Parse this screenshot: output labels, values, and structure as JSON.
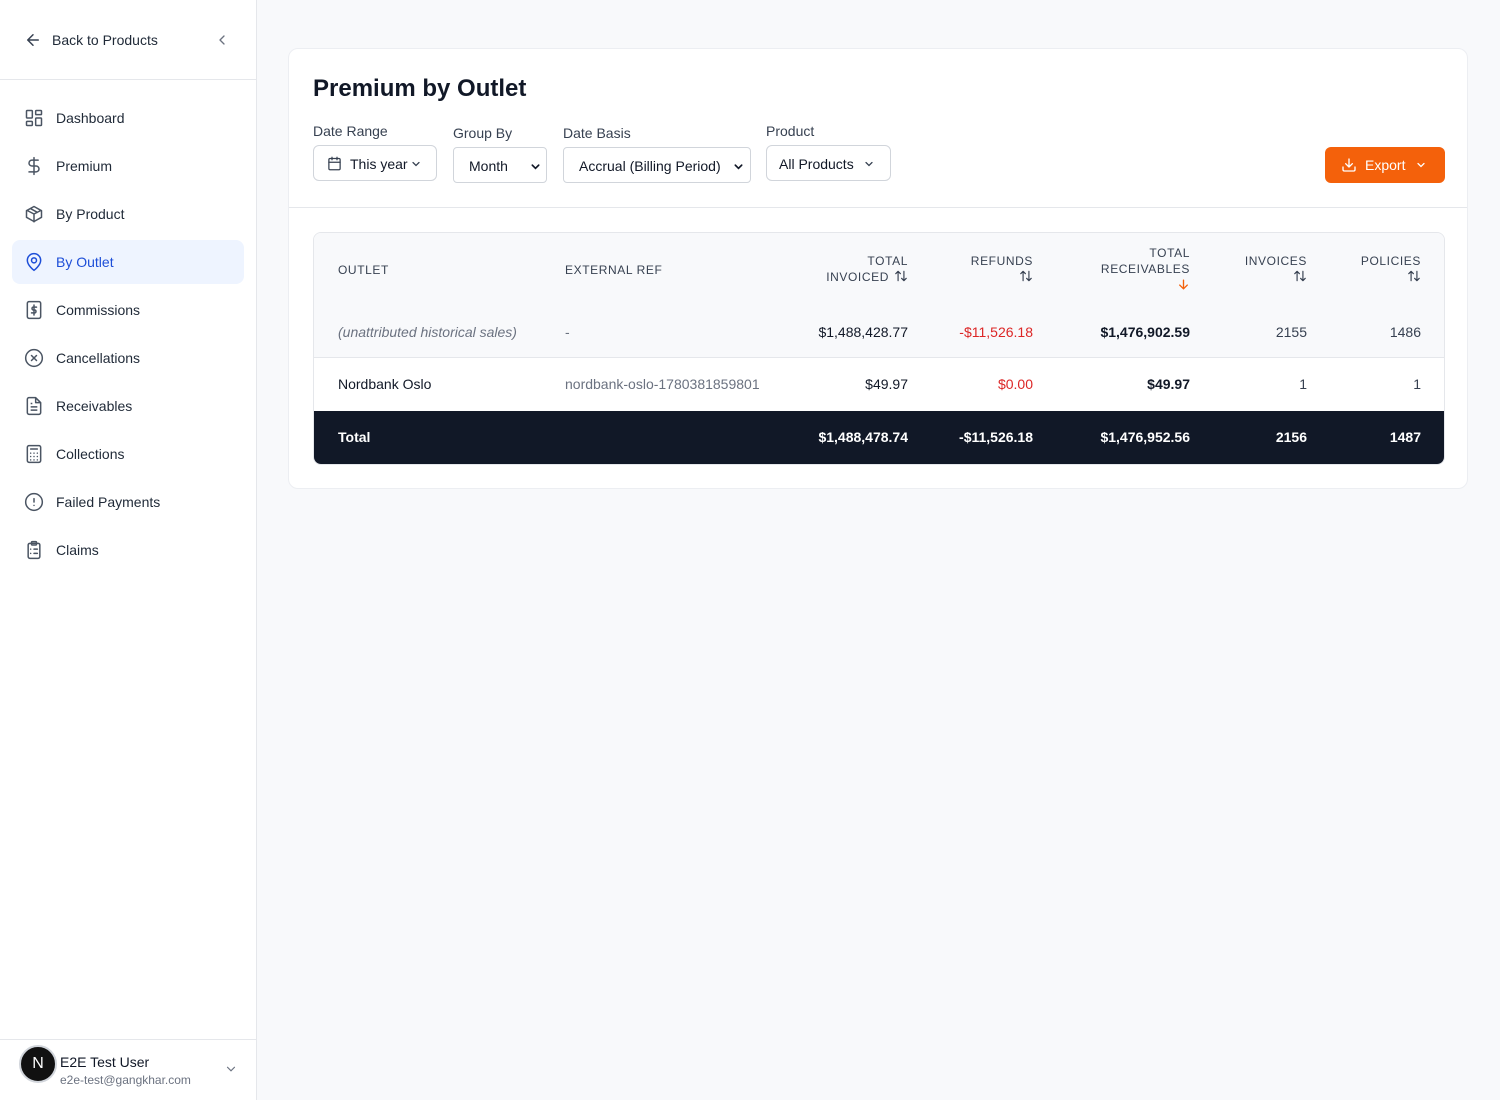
{
  "sidebar": {
    "back_label": "Back to Products",
    "items": [
      {
        "label": "Dashboard",
        "icon": "grid-icon",
        "active": false
      },
      {
        "label": "Premium",
        "icon": "dollar-icon",
        "active": false
      },
      {
        "label": "By Product",
        "icon": "box-icon",
        "active": false
      },
      {
        "label": "By Outlet",
        "icon": "map-pin-icon",
        "active": true
      },
      {
        "label": "Commissions",
        "icon": "receipt-dollar-icon",
        "active": false
      },
      {
        "label": "Cancellations",
        "icon": "x-circle-icon",
        "active": false
      },
      {
        "label": "Receivables",
        "icon": "file-text-icon",
        "active": false
      },
      {
        "label": "Collections",
        "icon": "calculator-icon",
        "active": false
      },
      {
        "label": "Failed Payments",
        "icon": "alert-circle-icon",
        "active": false
      },
      {
        "label": "Claims",
        "icon": "clipboard-list-icon",
        "active": false
      }
    ],
    "user": {
      "initial": "N",
      "name": "E2E Test User",
      "email": "e2e-test@gangkhar.com"
    }
  },
  "page": {
    "title": "Premium by Outlet",
    "filters": {
      "date_range": {
        "label": "Date Range",
        "value": "This year"
      },
      "group_by": {
        "label": "Group By",
        "value": "Month"
      },
      "date_basis": {
        "label": "Date Basis",
        "value": "Accrual (Billing Period)"
      },
      "product": {
        "label": "Product",
        "value": "All Products"
      }
    },
    "export_label": "Export"
  },
  "table": {
    "headers": {
      "outlet": "Outlet",
      "external_ref": "External Ref",
      "total_invoiced_1": "Total",
      "total_invoiced_2": "Invoiced",
      "refunds": "Refunds",
      "total_receivables_1": "Total",
      "total_receivables_2": "Receivables",
      "invoices": "Invoices",
      "policies": "Policies"
    },
    "sorted_column": "total_receivables",
    "rows": [
      {
        "outlet": "(unattributed historical sales)",
        "external_ref": "-",
        "total_invoiced": "$1,488,428.77",
        "refunds": "-$11,526.18",
        "total_receivables": "$1,476,902.59",
        "invoices": "2155",
        "policies": "1486"
      },
      {
        "outlet": "Nordbank Oslo",
        "external_ref": "nordbank-oslo-1780381859801",
        "total_invoiced": "$49.97",
        "refunds": "$0.00",
        "total_receivables": "$49.97",
        "invoices": "1",
        "policies": "1"
      }
    ],
    "total": {
      "label": "Total",
      "total_invoiced": "$1,488,478.74",
      "refunds": "-$11,526.18",
      "total_receivables": "$1,476,952.56",
      "invoices": "2156",
      "policies": "1487"
    }
  },
  "colors": {
    "accent": "#f4610b",
    "active_nav": "#1d4ed8",
    "negative": "#dc2626",
    "total_row": "#111827"
  }
}
